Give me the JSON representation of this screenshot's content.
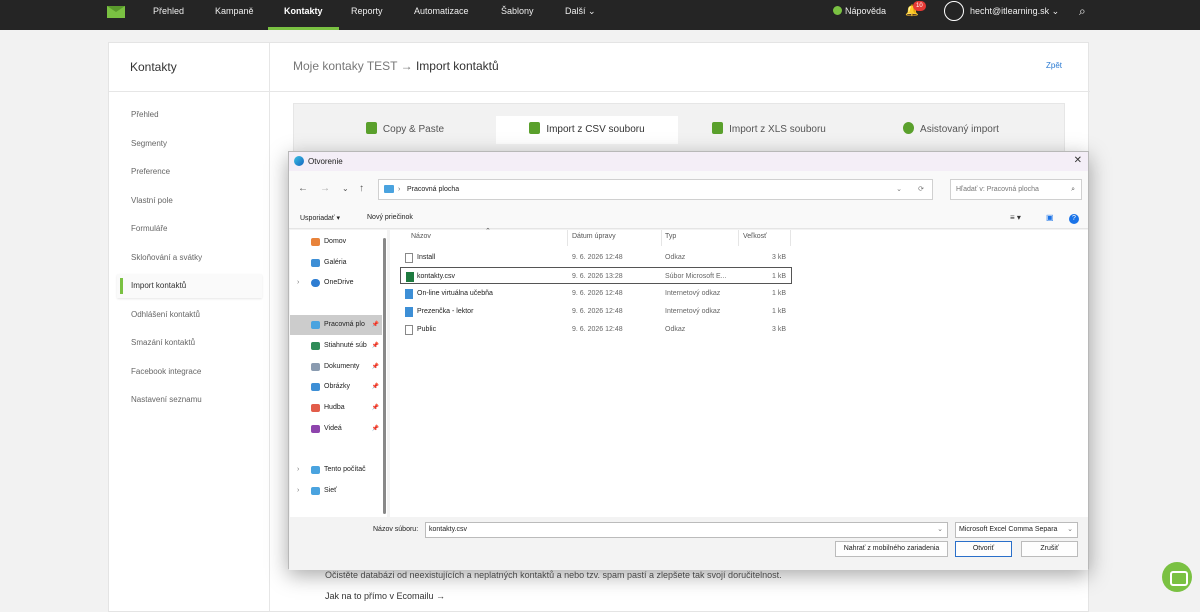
{
  "topbar": {
    "nav": [
      "Přehled",
      "Kampaně",
      "Kontakty",
      "Reporty",
      "Automatizace",
      "Šablony",
      "Další ⌄"
    ],
    "help": "Nápověda",
    "notifications": "10",
    "user": "hecht@itlearning.sk ⌄"
  },
  "sidebar": {
    "title": "Kontakty",
    "items": [
      "Přehled",
      "Segmenty",
      "Preference",
      "Vlastní pole",
      "Formuláře",
      "Skloňování a svátky",
      "Import kontaktů",
      "Odhlášení kontaktů",
      "Smazání kontaktů",
      "Facebook integrace",
      "Nastavení seznamu"
    ]
  },
  "header": {
    "list": "Moje kontaky TEST",
    "arrow": "→",
    "page": "Import kontaktů",
    "back": "Zpět"
  },
  "tabs": [
    "Copy & Paste",
    "Import z CSV souboru",
    "Import z XLS souboru",
    "Asistovaný import"
  ],
  "bottom": {
    "text": "Očistěte databázi od neexistujících a neplatných kontaktů a nebo tzv. spam pastí a zlepšete tak svojí doručitelnost.",
    "link": "Jak na to přímo v Ecomailu →"
  },
  "dialog": {
    "title": "Otvorenie",
    "path": "Pracovná plocha",
    "search_placeholder": "Hľadať v: Pracovná plocha",
    "organize": "Usporiadať ▾",
    "new_folder": "Nový priečinok",
    "nav": [
      {
        "label": "Domov",
        "color": "#e8833a"
      },
      {
        "label": "Galéria",
        "color": "#3d8fd6"
      },
      {
        "label": "OneDrive",
        "color": "#2d7dd2"
      },
      {
        "label": "Pracovná plo",
        "color": "#4aa3df"
      },
      {
        "label": "Stiahnuté súb",
        "color": "#2e8b57"
      },
      {
        "label": "Dokumenty",
        "color": "#8a9bb0"
      },
      {
        "label": "Obrázky",
        "color": "#3d8fd6"
      },
      {
        "label": "Hudba",
        "color": "#e25c4a"
      },
      {
        "label": "Videá",
        "color": "#8e44ad"
      },
      {
        "label": "Tento počítač",
        "color": "#4aa3df"
      },
      {
        "label": "Sieť",
        "color": "#4aa3df"
      }
    ],
    "columns": [
      "Názov",
      "Dátum úpravy",
      "Typ",
      "Veľkosť"
    ],
    "files": [
      {
        "name": "Install",
        "date": "9. 6. 2026 12:48",
        "type": "Odkaz",
        "size": "3 kB",
        "kind": "lnk"
      },
      {
        "name": "kontakty.csv",
        "date": "9. 6. 2026 13:28",
        "type": "Súbor Microsoft E...",
        "size": "1 kB",
        "kind": "csv"
      },
      {
        "name": "On-line virtuálna učebňa",
        "date": "9. 6. 2026 12:48",
        "type": "Internetový odkaz",
        "size": "1 kB",
        "kind": "url"
      },
      {
        "name": "Prezenčka - lektor",
        "date": "9. 6. 2026 12:48",
        "type": "Internetový odkaz",
        "size": "1 kB",
        "kind": "url"
      },
      {
        "name": "Public",
        "date": "9. 6. 2026 12:48",
        "type": "Odkaz",
        "size": "3 kB",
        "kind": "lnk"
      }
    ],
    "filename_label": "Názov súboru:",
    "filename": "kontakty.csv",
    "filetype": "Microsoft Excel Comma Separa",
    "btn_mobile": "Nahrať z mobilného zariadenia",
    "btn_open": "Otvoriť",
    "btn_cancel": "Zrušiť"
  }
}
